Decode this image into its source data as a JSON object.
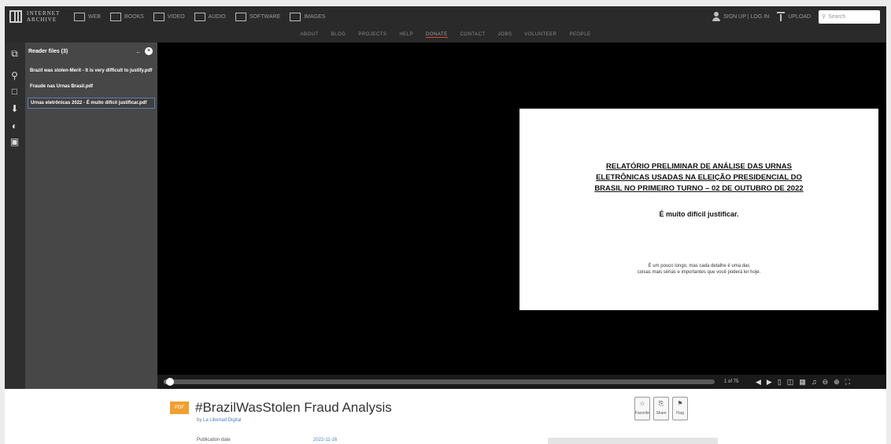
{
  "header": {
    "logo_line1": "INTERNET",
    "logo_line2": "ARCHIVE",
    "media": [
      {
        "label": "WEB",
        "icon": "web-icon"
      },
      {
        "label": "BOOKS",
        "icon": "book-icon"
      },
      {
        "label": "VIDEO",
        "icon": "video-icon"
      },
      {
        "label": "AUDIO",
        "icon": "audio-icon"
      },
      {
        "label": "SOFTWARE",
        "icon": "software-icon"
      },
      {
        "label": "IMAGES",
        "icon": "image-icon"
      }
    ],
    "signin": "SIGN UP | LOG IN",
    "upload": "UPLOAD",
    "search_placeholder": "Search"
  },
  "subnav": [
    "ABOUT",
    "BLOG",
    "PROJECTS",
    "HELP",
    "DONATE",
    "CONTACT",
    "JOBS",
    "VOLUNTEER",
    "PEOPLE"
  ],
  "subnav_active": "DONATE",
  "sidebar": {
    "title": "Reader files (3)",
    "files": [
      "Brazil was stolen-Merit - It is very difficult to justify.pdf",
      "Fraude nas Urnas Brasil.pdf",
      "Urnas eletrônicas 2022 - É muito difícil justificar.pdf"
    ],
    "selected_index": 2
  },
  "slide": {
    "title_line1": "RELATÓRIO PRELIMINAR DE ANÁLISE DAS URNAS",
    "title_line2": "ELETRÔNICAS USADAS NA ELEIÇÃO PRESIDENCIAL DO",
    "title_line3": "BRASIL NO PRIMEIRO TURNO – 02 DE OUTUBRO DE 2022",
    "subtitle": "É muito difícil justificar.",
    "note_line1": "É um pouco longo, mas cada detalhe é uma das",
    "note_line2": "coisas mais sérias e importantes que você poderá ler hoje."
  },
  "player": {
    "progress": 0.01,
    "page_indicator": "1 of 75"
  },
  "item": {
    "badge": "PDF",
    "title": "#BrazilWasStolen Fraud Analysis",
    "by_prefix": "by",
    "author": "La Libertad Digital",
    "published_label": "Publication date",
    "published_value": "2022-11-16",
    "actions": [
      {
        "label": "Favorite",
        "icon": "star-icon",
        "glyph": "☆"
      },
      {
        "label": "Share",
        "icon": "share-icon",
        "glyph": "⎘"
      },
      {
        "label": "Flag",
        "icon": "flag-icon",
        "glyph": "⚑"
      }
    ]
  },
  "colors": {
    "topbar": "#2a2a2a",
    "panel": "#474747",
    "badge": "#f0a030",
    "link": "#4a7fc0",
    "active_underline": "#d24a3a"
  }
}
